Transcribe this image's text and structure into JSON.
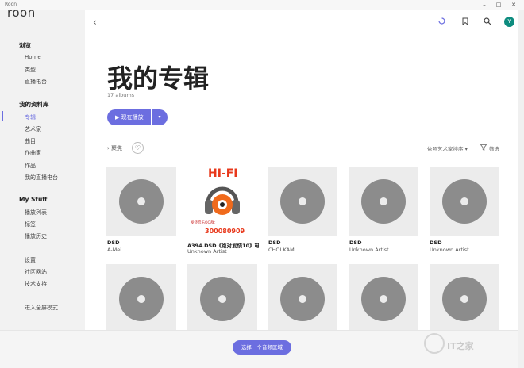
{
  "window": {
    "title": "Roon",
    "minimize": "–",
    "maximize": "□",
    "close": "✕"
  },
  "logo": "roon",
  "sidebar": {
    "browse_title": "浏览",
    "browse_items": [
      "Home",
      "类型",
      "直播电台"
    ],
    "library_title": "我的资料库",
    "library_items": [
      "专辑",
      "艺术家",
      "曲目",
      "作曲家",
      "作品",
      "我的直播电台"
    ],
    "mystuff_title": "My Stuff",
    "mystuff_items": [
      "播放列表",
      "标签",
      "播放历史"
    ],
    "other_items": [
      "设置",
      "社区网站",
      "技术支持"
    ],
    "fullscreen": "进入全屏模式"
  },
  "header": {
    "back": "‹",
    "avatar": "Y"
  },
  "main": {
    "title": "我的专辑",
    "count": "17 albums",
    "play_label": "▶ 现在播放",
    "play_drop": "▾",
    "focus_label": "› 聚焦",
    "heart": "♡",
    "sort_label": "依照艺术家排序 ▾",
    "filter_label": "筛选"
  },
  "albums": [
    {
      "title": "DSD",
      "artist": "A-Mei"
    },
    {
      "title": "A394.DSD《绝对发烧10》鞋...",
      "artist": "Unknown Artist"
    },
    {
      "title": "DSD",
      "artist": "CHOI KAM"
    },
    {
      "title": "DSD",
      "artist": "Unknown Artist"
    },
    {
      "title": "DSD",
      "artist": "Unknown Artist"
    }
  ],
  "cover": {
    "brand": "HI-FI",
    "caption": "发烧音乐QQ群：",
    "number": "300080909"
  },
  "zone_button": "选择一个音频区域",
  "watermark": "IT之家"
}
